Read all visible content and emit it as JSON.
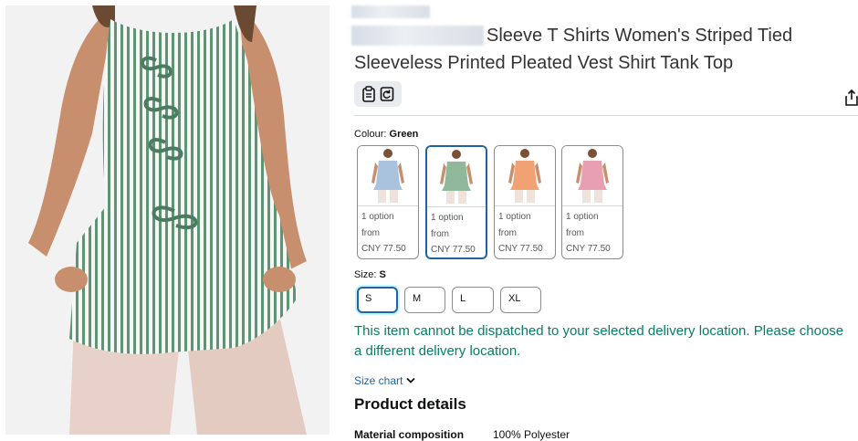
{
  "product": {
    "title_visible": "Sleeve T Shirts Women's Striped Tied Sleeveless Printed Pleated Vest Shirt Tank Top"
  },
  "colour": {
    "label": "Colour: ",
    "selected": "Green",
    "swatches": [
      {
        "color_name": "Blue",
        "shirt_color": "#a9c2dd",
        "line1": "1 option",
        "line2": "from",
        "price": "CNY 77.50"
      },
      {
        "color_name": "Green",
        "shirt_color": "#8fb79a",
        "line1": "1 option",
        "line2": "from",
        "price": "CNY 77.50"
      },
      {
        "color_name": "Orange",
        "shirt_color": "#f0a274",
        "line1": "1 option",
        "line2": "from",
        "price": "CNY 77.50"
      },
      {
        "color_name": "Pink",
        "shirt_color": "#e89fb2",
        "line1": "1 option",
        "line2": "from",
        "price": "CNY 77.50"
      }
    ]
  },
  "size": {
    "label": "Size: ",
    "selected": "S",
    "options": [
      "S",
      "M",
      "L",
      "XL"
    ]
  },
  "delivery_message": "This item cannot be dispatched to your selected delivery location. Please choose a different delivery location.",
  "size_chart_label": "Size chart",
  "details": {
    "heading": "Product details",
    "rows": [
      {
        "key": "Material composition",
        "value": "100% Polyester"
      }
    ]
  },
  "colors": {
    "link": "#2162a1",
    "success": "#067d62",
    "selected_border": "#2162a1"
  },
  "icons": [
    "clipboard-icon",
    "refresh-page-icon",
    "share-icon",
    "chevron-down-icon"
  ]
}
